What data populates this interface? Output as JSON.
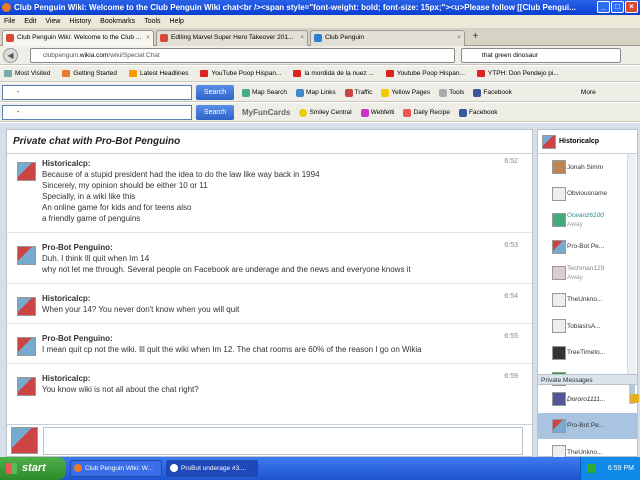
{
  "window": {
    "title": "Club Penguin Wiki: Welcome to the Club Penguin Wiki chat<br /><span style=\"font-weight: bold; font-size: 15px;\"><u>Please follow [[Club Pengui..."
  },
  "menu": [
    "File",
    "Edit",
    "View",
    "History",
    "Bookmarks",
    "Tools",
    "Help"
  ],
  "tabs": [
    {
      "label": "Club Penguin Wiki: Welcome to the Club ...",
      "active": true
    },
    {
      "label": "Editing Marvel Super Hero Takeover 201...",
      "active": false
    },
    {
      "label": "Club Penguin",
      "active": false
    }
  ],
  "nav": {
    "url_prefix": "clubpenguin.",
    "url_domain": "wikia.com",
    "url_path": "/wiki/Special:Chat",
    "search_value": "that green dinosaur"
  },
  "bookmarks": [
    "Most Visited",
    "Getting Started",
    "Latest Headlines",
    "YouTube Poop Hispan...",
    "la mordida de la nuez ...",
    "Youtube Poop Hispan...",
    "YTPH: Don Pendejo pi...",
    "More"
  ],
  "toolbar1": {
    "search_value": "-",
    "search_btn": "Search",
    "items": [
      "Map Search",
      "Map Links",
      "Traffic",
      "Yellow Pages",
      "Tools",
      "Facebook"
    ],
    "more": "More"
  },
  "toolbar2": {
    "search_value": "-",
    "search_btn": "Search",
    "brand": "MyFunCards",
    "items": [
      "Smiley Central",
      "Webfetti",
      "Daily Recipe",
      "Facebook"
    ]
  },
  "chat": {
    "title": "Private chat with Pro-Bot Penguino",
    "messages": [
      {
        "user": "Historicalcp:",
        "time": "6:52",
        "lines": [
          "Because of a stupid president had the idea to do the law like way back in 1994",
          "Sincerely, my opinion should be either 10 or 11",
          "Specially, in a wiki like this",
          "An online game for kids and for teens also",
          "a friendly game of penguins"
        ]
      },
      {
        "user": "Pro-Bot Penguino:",
        "time": "6:53",
        "lines": [
          "Duh. I think Ill quit when Im 14",
          "why not let me through. Several people on Facebook are underage and the news and everyone knows it"
        ]
      },
      {
        "user": "Historicalcp:",
        "time": "6:54",
        "lines": [
          "When your 14? You never don't know when you will quit"
        ]
      },
      {
        "user": "Pro-Bot Penguino:",
        "time": "6:55",
        "lines": [
          "I mean quit cp not the wiki. Ill quit the wiki when Im 12. The chat rooms are 60% of the reason I go on Wikia"
        ]
      },
      {
        "user": "Historicalcp:",
        "time": "6:59",
        "lines": [
          "You know wiki is not all about the chat right?"
        ]
      }
    ]
  },
  "sidebar": {
    "me": "Historicalcp",
    "users": [
      {
        "name": "Jonah Simm",
        "status": ""
      },
      {
        "name": "Obviousname",
        "status": ""
      },
      {
        "name": "Oceanz6100",
        "status": "Away"
      },
      {
        "name": "Pro-Bot Pe...",
        "status": ""
      },
      {
        "name": "Techman129",
        "status": "Away"
      },
      {
        "name": "TheUnkno...",
        "status": ""
      },
      {
        "name": "TobiasIsA...",
        "status": ""
      },
      {
        "name": "TreeTimeto...",
        "status": ""
      },
      {
        "name": "7winkie102",
        "status": ""
      }
    ],
    "pm_header": "Private Messages",
    "pms": [
      {
        "name": "Dororo1111..."
      },
      {
        "name": "Pro-Bot Pe..."
      },
      {
        "name": "TheUnkno..."
      }
    ]
  },
  "taskbar": {
    "start": "start",
    "tasks": [
      "Club Penguin Wiki: W...",
      "ProBot underage #3...."
    ],
    "clock": "6:59 PM"
  }
}
